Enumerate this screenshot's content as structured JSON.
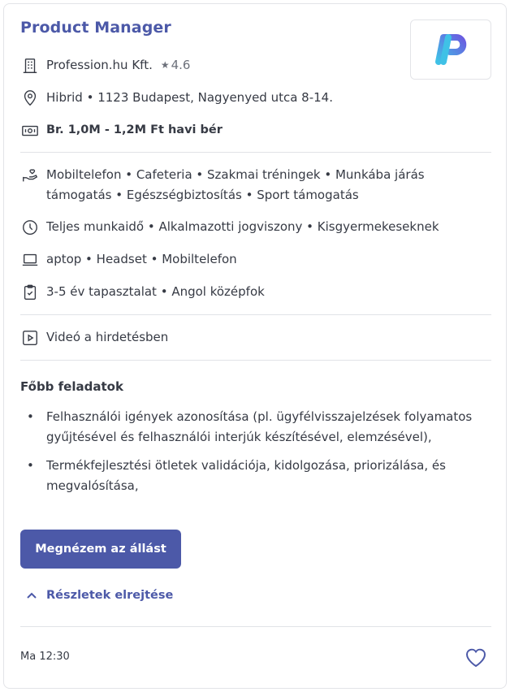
{
  "job": {
    "title": "Product Manager",
    "company": "Profession.hu Kft.",
    "rating": "4.6",
    "location": "Hibrid • 1123 Budapest, Nagyenyed utca 8-14.",
    "salary": "Br. 1,0M - 1,2M Ft havi bér"
  },
  "details": {
    "benefits": "Mobiltelefon • Cafeteria • Szakmai tréningek • Munkába járás támogatás • Egészségbiztosítás • Sport támogatás",
    "employment": "Teljes munkaidő • Alkalmazotti jogviszony • Kisgyermekeseknek",
    "equipment": "aptop • Headset • Mobiltelefon",
    "requirements": "3-5 év tapasztalat • Angol középfok",
    "video": "Videó a hirdetésben"
  },
  "tasks": {
    "heading": "Főbb feladatok",
    "items": [
      "Felhasználói igények azonosítása (pl. ügyfélvisszajelzések folyamatos gyűjtésével és felhasználói interjúk készítésével, elemzésével),",
      "Termékfejlesztési ötletek validációja, kidolgozása, priorizálása, és megvalósítása,"
    ]
  },
  "actions": {
    "view_button": "Megnézem az állást",
    "hide_details": "Részletek elrejtése"
  },
  "footer": {
    "posted": "Ma 12:30"
  },
  "colors": {
    "accent": "#4c59a8",
    "text": "#363a44",
    "logo_gradient_start": "#3fc1e6",
    "logo_gradient_end": "#6a5be0"
  },
  "icons": [
    "building-icon",
    "star-icon",
    "location-pin-icon",
    "banknote-icon",
    "hand-heart-icon",
    "clock-icon",
    "laptop-icon",
    "clipboard-check-icon",
    "play-video-icon",
    "chevron-up-icon",
    "heart-icon"
  ]
}
